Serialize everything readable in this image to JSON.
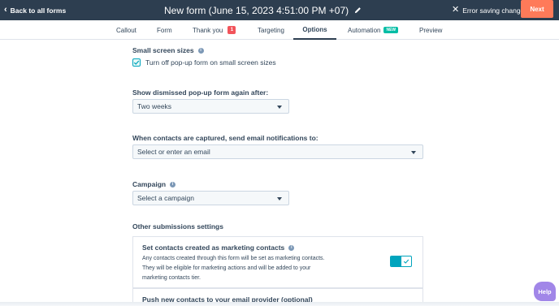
{
  "topbar": {
    "back_label": "Back to all forms",
    "title": "New form (June 15, 2023 4:51:00 PM +07)",
    "error_label": "Error saving changes",
    "next_label": "Next"
  },
  "tabs": [
    {
      "label": "Callout"
    },
    {
      "label": "Form"
    },
    {
      "label": "Thank you",
      "count": "1"
    },
    {
      "label": "Targeting"
    },
    {
      "label": "Options",
      "active": true
    },
    {
      "label": "Automation",
      "badge": "NEW"
    },
    {
      "label": "Preview"
    }
  ],
  "options": {
    "small_screen": {
      "label": "Small screen sizes",
      "checkbox_label": "Turn off pop-up form on small screen sizes",
      "checked": true
    },
    "dismissed": {
      "label": "Show dismissed pop-up form again after:",
      "value": "Two weeks"
    },
    "notifications": {
      "label": "When contacts are captured, send email notifications to:",
      "placeholder": "Select or enter an email"
    },
    "campaign": {
      "label": "Campaign",
      "placeholder": "Select a campaign"
    },
    "other_settings": {
      "heading": "Other submissions settings",
      "marketing": {
        "title": "Set contacts created as marketing contacts",
        "description": "Any contacts created through this form will be set as marketing contacts. They will be eligible for marketing actions and will be added to your marketing contacts tier.",
        "enabled": true
      },
      "email_provider": {
        "title": "Push new contacts to your email provider (optional)"
      }
    }
  },
  "help": {
    "label": "Help"
  },
  "colors": {
    "topbar": "#2d3e50",
    "accent_orange": "#ff7a59",
    "teal": "#00a4bd",
    "badge_red": "#f2545b",
    "badge_green": "#00bda5",
    "help_purple": "#a186e8"
  }
}
